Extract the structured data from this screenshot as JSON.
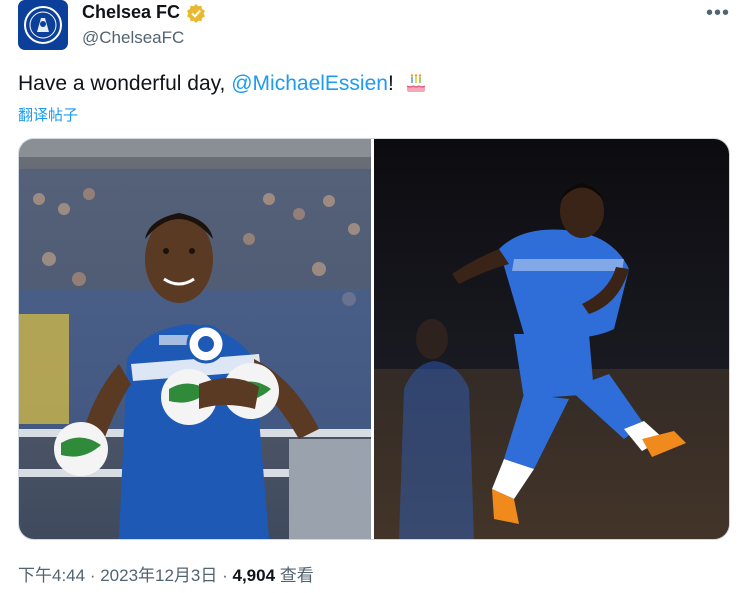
{
  "account": {
    "display_name": "Chelsea FC",
    "handle": "@ChelseaFC",
    "verified": true,
    "more_icon": "more-horizontal-icon"
  },
  "tweet": {
    "text_before": "Have a wonderful day, ",
    "mention": "@MichaelEssien",
    "text_after": "!",
    "emoji": "birthday-cake",
    "translate_label": "翻译帖子"
  },
  "meta": {
    "time": "下午4:44",
    "separator": " · ",
    "date": "2023年12月3日",
    "views": "4,904",
    "views_label": "查看"
  },
  "colors": {
    "link": "#1d9bf0",
    "muted": "#536471",
    "chelsea_blue": "#0b3f9a",
    "verified_gold": "#e8b92f"
  }
}
